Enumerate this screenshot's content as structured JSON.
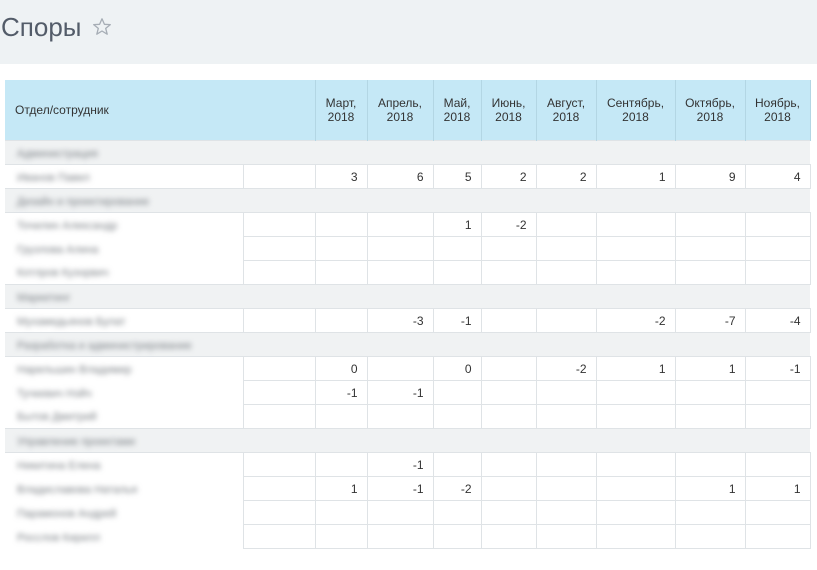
{
  "header": {
    "title": "Споры",
    "star_icon": "star-outline-icon"
  },
  "table": {
    "first_col_header": "Отдел/сотрудник",
    "months": [
      [
        "Март,",
        "2018"
      ],
      [
        "Апрель,",
        "2018"
      ],
      [
        "Май,",
        "2018"
      ],
      [
        "Июнь,",
        "2018"
      ],
      [
        "Август,",
        "2018"
      ],
      [
        "Сентябрь,",
        "2018"
      ],
      [
        "Октябрь,",
        "2018"
      ],
      [
        "Ноябрь,",
        "2018"
      ]
    ],
    "rows": [
      {
        "type": "group",
        "label": "Администрация"
      },
      {
        "type": "person",
        "label": "Иванов Павел",
        "values": [
          "3",
          "6",
          "5",
          "2",
          "2",
          "1",
          "9",
          "4"
        ]
      },
      {
        "type": "group",
        "label": "Дизайн и проектирование"
      },
      {
        "type": "person",
        "label": "Точилин Александр",
        "values": [
          "",
          "",
          "1",
          "-2",
          "",
          "",
          "",
          ""
        ]
      },
      {
        "type": "person",
        "label": "Грузлова Алина",
        "values": [
          "",
          "",
          "",
          "",
          "",
          "",
          "",
          ""
        ]
      },
      {
        "type": "person",
        "label": "Котлров Кузнрвич",
        "values": [
          "",
          "",
          "",
          "",
          "",
          "",
          "",
          ""
        ]
      },
      {
        "type": "group",
        "label": "Маркетинг"
      },
      {
        "type": "person",
        "label": "Мухамедьянов Булат",
        "values": [
          "",
          "-3",
          "-1",
          "",
          "",
          "-2",
          "-7",
          "-4"
        ]
      },
      {
        "type": "group",
        "label": "Разработка и администрирование"
      },
      {
        "type": "person",
        "label": "Нарельшин Владимир",
        "values": [
          "0",
          "",
          "0",
          "",
          "-2",
          "1",
          "1",
          "-1"
        ]
      },
      {
        "type": "person",
        "label": "Тучкевич Нэйч",
        "values": [
          "-1",
          "-1",
          "",
          "",
          "",
          "",
          "",
          ""
        ]
      },
      {
        "type": "person",
        "label": "Бытов Дмитрий",
        "values": [
          "",
          "",
          "",
          "",
          "",
          "",
          "",
          ""
        ]
      },
      {
        "type": "group",
        "label": "Управление проектами"
      },
      {
        "type": "person",
        "label": "Никитина Елена",
        "values": [
          "",
          "-1",
          "",
          "",
          "",
          "",
          "",
          ""
        ]
      },
      {
        "type": "person",
        "label": "Владиславова Наталья",
        "values": [
          "1",
          "-1",
          "-2",
          "",
          "",
          "",
          "1",
          "1"
        ]
      },
      {
        "type": "person",
        "label": "Парамонов Андрей",
        "values": [
          "",
          "",
          "",
          "",
          "",
          "",
          "",
          ""
        ]
      },
      {
        "type": "person",
        "label": "Росслов Кирилл",
        "values": [
          "",
          "",
          "",
          "",
          "",
          "",
          "",
          ""
        ]
      }
    ]
  }
}
